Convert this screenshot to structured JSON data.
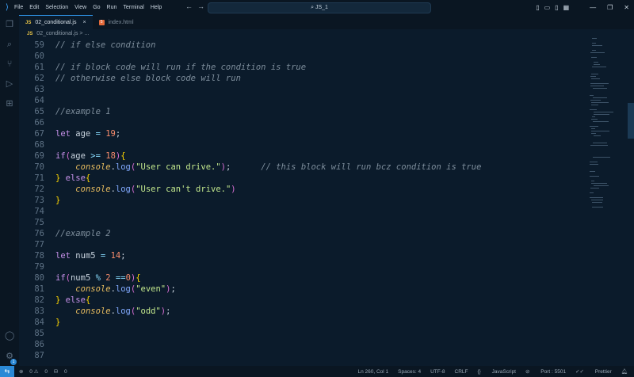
{
  "titlebar": {
    "menu": [
      "File",
      "Edit",
      "Selection",
      "View",
      "Go",
      "Run",
      "Terminal",
      "Help"
    ],
    "search": "JS_1"
  },
  "tabs": [
    {
      "label": "02_conditional.js",
      "icon": "js-file-icon",
      "active": true
    },
    {
      "label": "index.html",
      "icon": "html-file-icon",
      "active": false
    }
  ],
  "breadcrumb": {
    "file": "02_conditional.js",
    "sep": ">",
    "rest": "..."
  },
  "code": [
    {
      "n": "59",
      "t": "// if else condition"
    },
    {
      "n": "60",
      "t": ""
    },
    {
      "n": "61",
      "t": "// if block code will run if the condition is true"
    },
    {
      "n": "62",
      "t": "// otherwise else block code will run"
    },
    {
      "n": "63",
      "t": ""
    },
    {
      "n": "64",
      "t": ""
    },
    {
      "n": "65",
      "t": "//example 1"
    },
    {
      "n": "66",
      "t": ""
    },
    {
      "n": "67",
      "t": "let age = 19;"
    },
    {
      "n": "68",
      "t": ""
    },
    {
      "n": "69",
      "t": "if(age >= 18){"
    },
    {
      "n": "70",
      "t": "    console.log(\"User can drive.\");      // this block will run bcz condition is true"
    },
    {
      "n": "71",
      "t": "} else{"
    },
    {
      "n": "72",
      "t": "    console.log(\"User can't drive.\")"
    },
    {
      "n": "73",
      "t": "}"
    },
    {
      "n": "74",
      "t": ""
    },
    {
      "n": "75",
      "t": ""
    },
    {
      "n": "76",
      "t": "//example 2"
    },
    {
      "n": "77",
      "t": ""
    },
    {
      "n": "78",
      "t": "let num5 = 14;"
    },
    {
      "n": "79",
      "t": ""
    },
    {
      "n": "80",
      "t": "if(num5 % 2 ==0){"
    },
    {
      "n": "81",
      "t": "    console.log(\"even\");"
    },
    {
      "n": "82",
      "t": "} else{"
    },
    {
      "n": "83",
      "t": "    console.log(\"odd\");"
    },
    {
      "n": "84",
      "t": "}"
    },
    {
      "n": "85",
      "t": ""
    },
    {
      "n": "86",
      "t": ""
    },
    {
      "n": "87",
      "t": ""
    }
  ],
  "statusbar": {
    "errors": "0",
    "warnings": "0",
    "ports": "0",
    "position": "Ln 260, Col 1",
    "spaces": "Spaces: 4",
    "encoding": "UTF-8",
    "eol": "CRLF",
    "language": "JavaScript",
    "port": "Port : 5501",
    "prettier": "Prettier"
  },
  "activity_badge": "1"
}
